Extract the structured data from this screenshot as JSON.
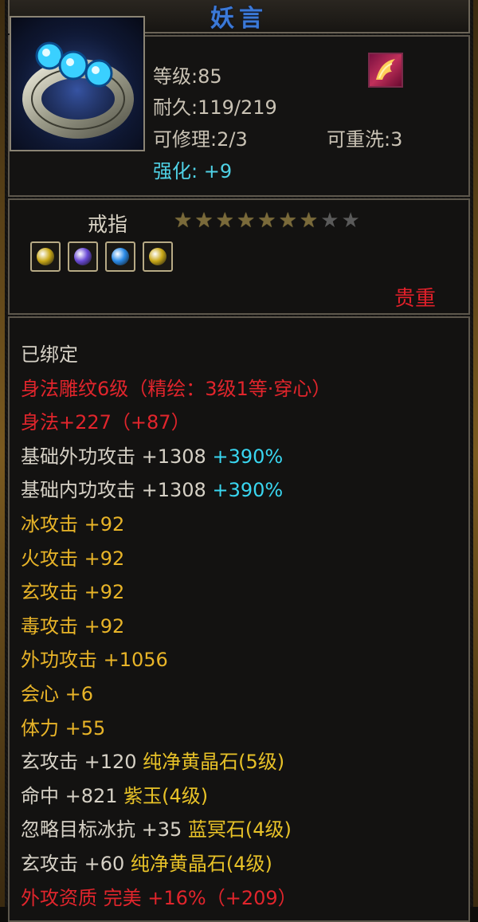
{
  "title": "妖言",
  "item": {
    "level": "等级:85",
    "durability": "耐久:119/219",
    "repairable": "可修理:2/3",
    "rewash": "可重洗:3",
    "enhance": "强化: +9",
    "name": "戒指",
    "rarity": "贵重",
    "stars_total": 9,
    "stars_lit": 7
  },
  "gems": [
    {
      "icon": "yellow-gem-icon",
      "color": "#c9a818"
    },
    {
      "icon": "purple-gem-icon",
      "color": "#6a4ad6"
    },
    {
      "icon": "blue-gem-icon",
      "color": "#2a8ae6"
    },
    {
      "icon": "yellow-gem-icon",
      "color": "#c9a818"
    }
  ],
  "attributes": [
    {
      "text": "已绑定",
      "class": "c-white"
    },
    {
      "text": "身法雕纹6级（精绘：3级1等·穿心）",
      "class": "c-red"
    },
    {
      "text": "身法+227（+87）",
      "class": "c-red"
    },
    {
      "text": "基础外功攻击 +1308",
      "extra": " +390%",
      "class": "c-white"
    },
    {
      "text": "基础内功攻击 +1308",
      "extra": " +390%",
      "class": "c-white"
    },
    {
      "text": "冰攻击 +92",
      "class": "c-gold"
    },
    {
      "text": "火攻击 +92",
      "class": "c-gold"
    },
    {
      "text": "玄攻击 +92",
      "class": "c-gold"
    },
    {
      "text": "毒攻击 +92",
      "class": "c-gold"
    },
    {
      "text": "外功攻击 +1056",
      "class": "c-gold"
    },
    {
      "text": "会心 +6",
      "class": "c-gold"
    },
    {
      "text": "体力 +55",
      "class": "c-gold"
    },
    {
      "text": "玄攻击 +120",
      "gem": " 纯净黄晶石(5级)",
      "class": "c-white"
    },
    {
      "text": "命中 +821",
      "gem": " 紫玉(4级)",
      "class": "c-white"
    },
    {
      "text": "忽略目标冰抗 +35",
      "gem": " 蓝冥石(4级)",
      "class": "c-white"
    },
    {
      "text": "玄攻击 +60",
      "gem": " 纯净黄晶石(4级)",
      "class": "c-white"
    },
    {
      "text": "外攻资质 完美 +16%（+209）",
      "class": "c-red"
    }
  ],
  "colors": {
    "title": "#3b79d8",
    "enhance": "#4fd2e6",
    "rarity": "#e0202a",
    "attr_red": "#e1252c",
    "attr_gold": "#e8b428",
    "attr_cyan": "#39d6f0"
  }
}
